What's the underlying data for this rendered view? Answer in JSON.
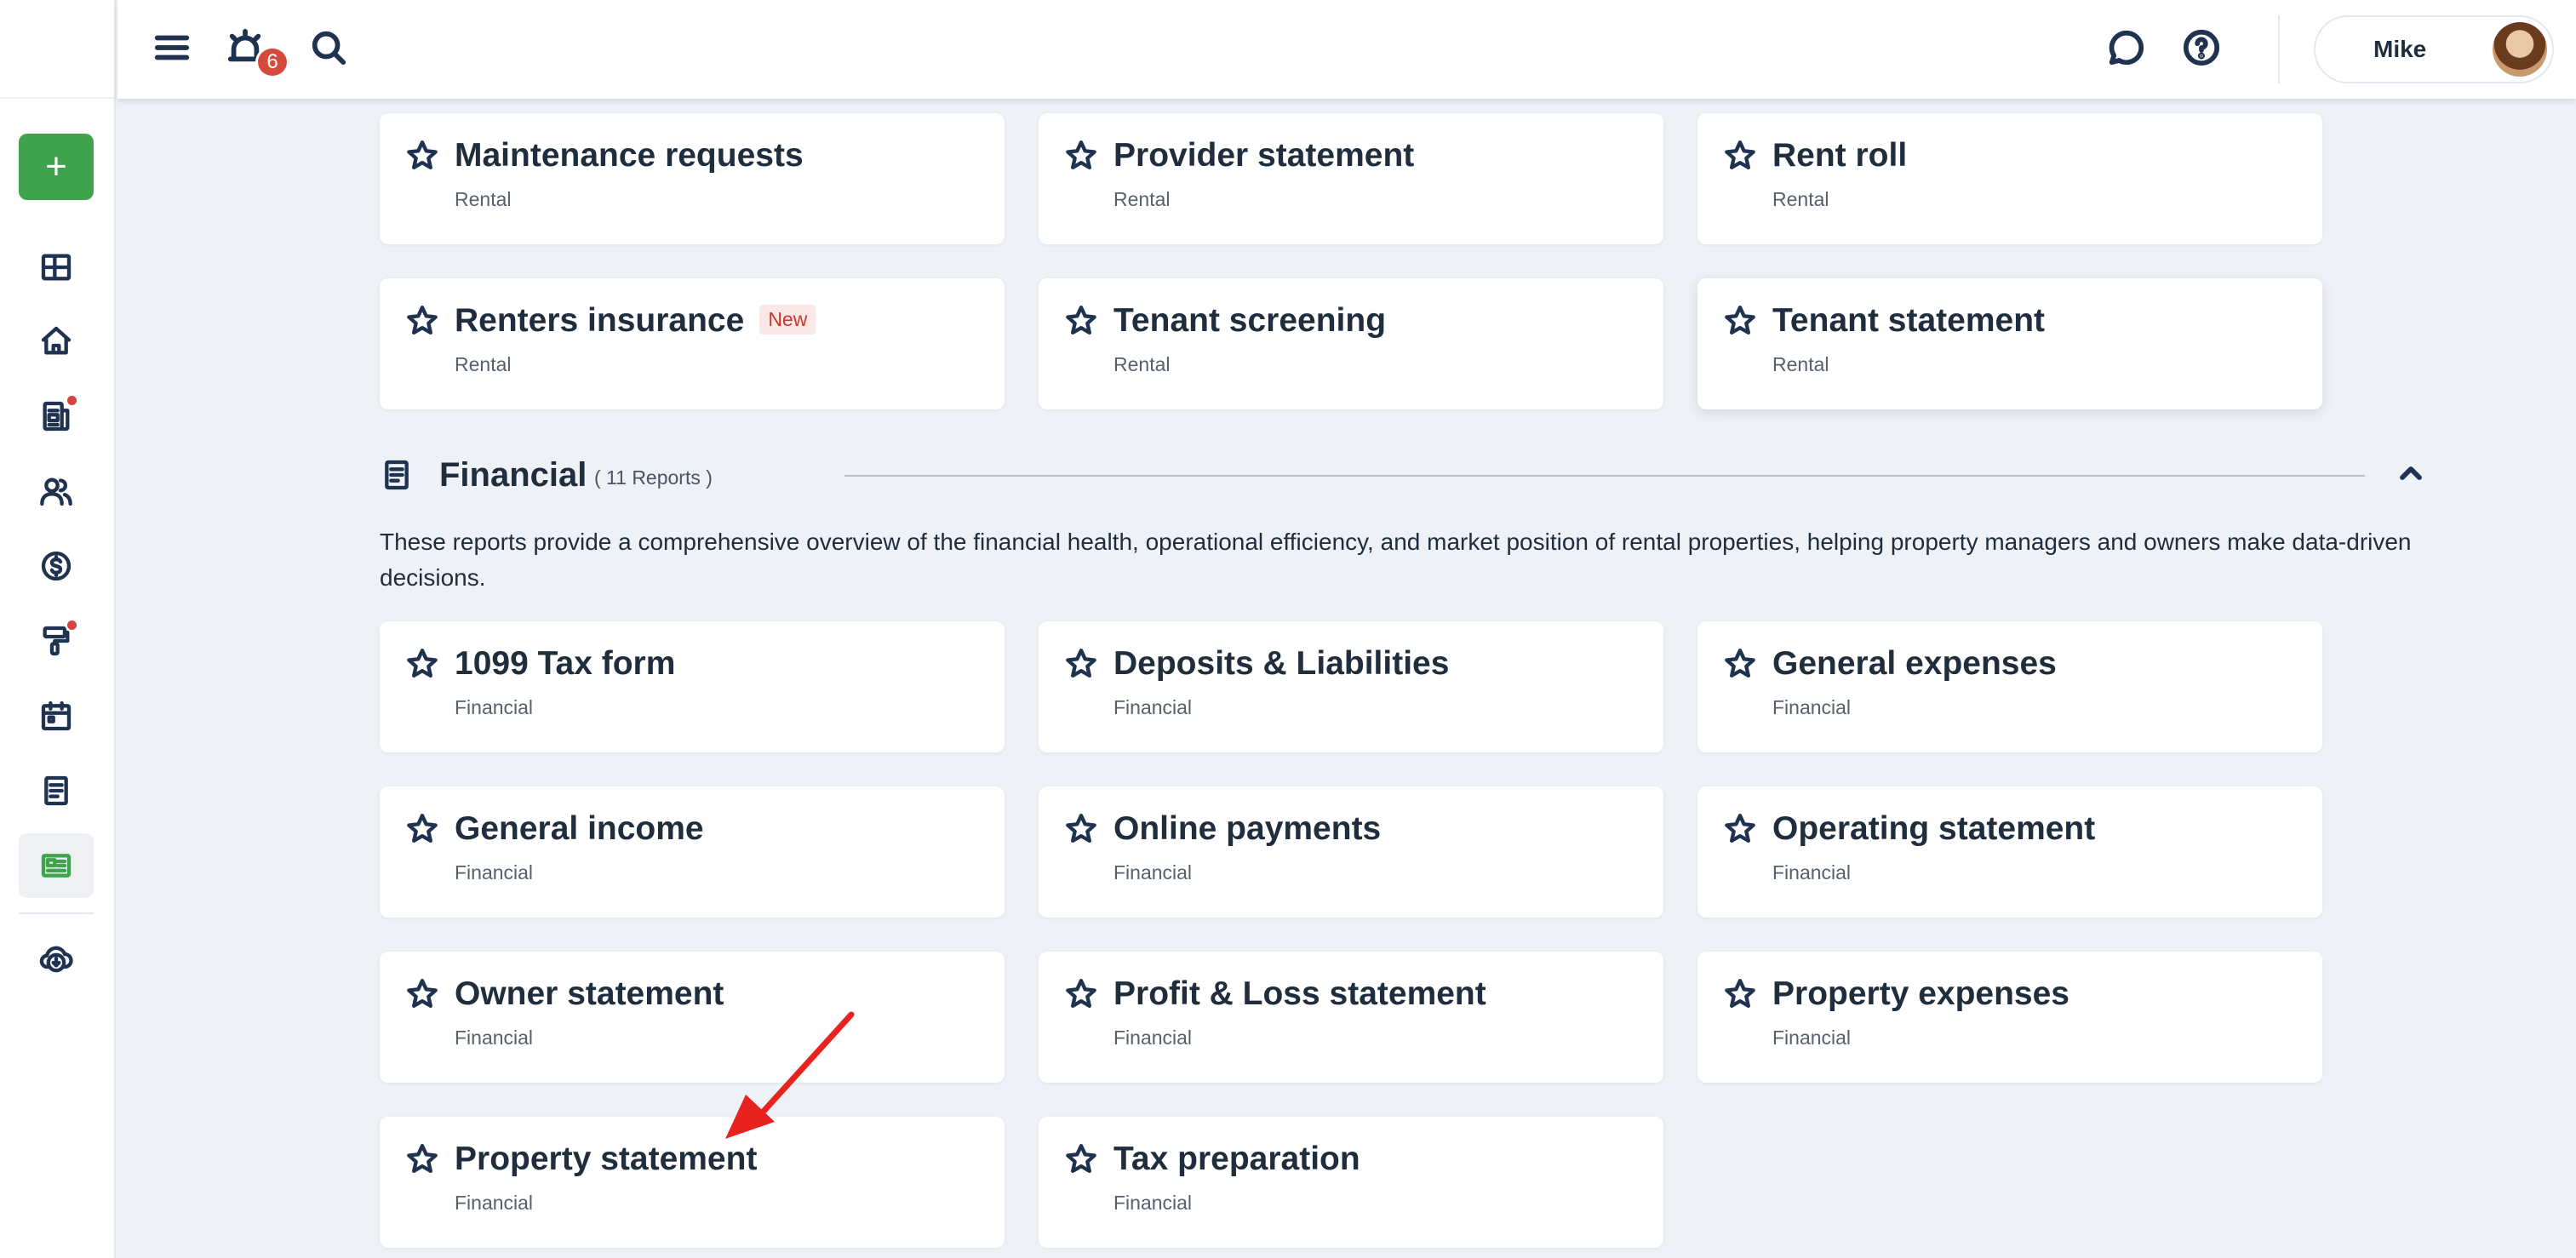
{
  "topbar": {
    "notification_count": "6",
    "user_name": "Mike"
  },
  "sidebar": {
    "add_label": "+",
    "items": [
      {
        "icon": "dashboard-icon"
      },
      {
        "icon": "home-icon"
      },
      {
        "icon": "leases-icon",
        "dot": true
      },
      {
        "icon": "people-icon"
      },
      {
        "icon": "dollar-icon"
      },
      {
        "icon": "maintenance-icon",
        "dot": true
      },
      {
        "icon": "calendar-icon"
      },
      {
        "icon": "document-icon"
      },
      {
        "icon": "reports-icon",
        "active": true
      },
      {
        "icon": "download-icon"
      }
    ]
  },
  "rental_cards": [
    {
      "title": "Maintenance requests",
      "category": "Rental"
    },
    {
      "title": "Provider statement",
      "category": "Rental"
    },
    {
      "title": "Rent roll",
      "category": "Rental"
    },
    {
      "title": "Renters insurance",
      "category": "Rental",
      "tag": "New"
    },
    {
      "title": "Tenant screening",
      "category": "Rental"
    },
    {
      "title": "Tenant statement",
      "category": "Rental"
    }
  ],
  "financial_section": {
    "title": "Financial",
    "count": "( 11 Reports )",
    "description": "These reports provide a comprehensive overview of the financial health, operational efficiency, and market position of rental properties, helping property managers and owners make data-driven decisions.",
    "cards": [
      {
        "title": "1099 Tax form",
        "category": "Financial"
      },
      {
        "title": "Deposits & Liabilities",
        "category": "Financial"
      },
      {
        "title": "General expenses",
        "category": "Financial"
      },
      {
        "title": "General income",
        "category": "Financial"
      },
      {
        "title": "Online payments",
        "category": "Financial"
      },
      {
        "title": "Operating statement",
        "category": "Financial"
      },
      {
        "title": "Owner statement",
        "category": "Financial"
      },
      {
        "title": "Profit & Loss statement",
        "category": "Financial"
      },
      {
        "title": "Property expenses",
        "category": "Financial"
      },
      {
        "title": "Property statement",
        "category": "Financial"
      },
      {
        "title": "Tax preparation",
        "category": "Financial"
      }
    ]
  },
  "colors": {
    "accent_green": "#3fa34d",
    "badge_red": "#d64a3c",
    "annotation_arrow": "#e8231f"
  }
}
